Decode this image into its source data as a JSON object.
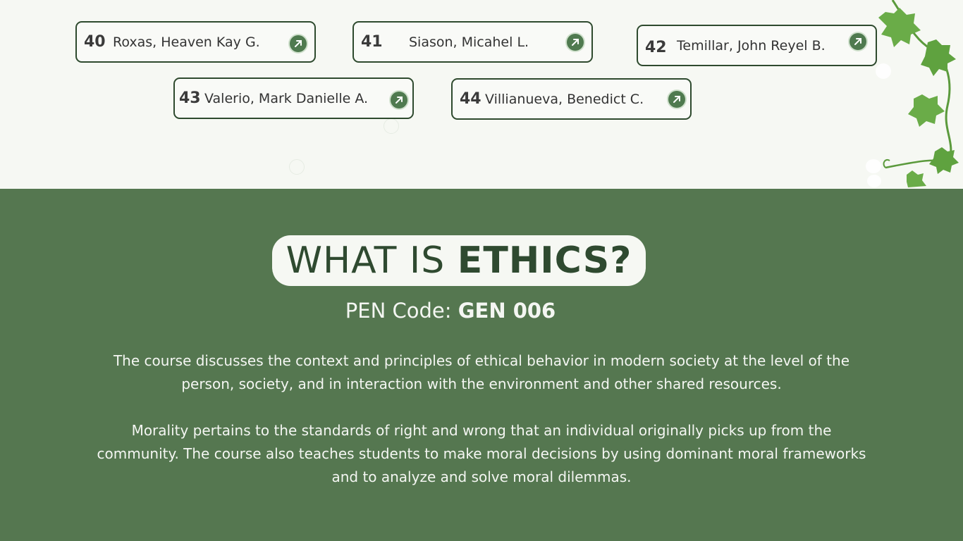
{
  "students": [
    {
      "number": "40",
      "name": "Roxas, Heaven Kay G."
    },
    {
      "number": "41",
      "name": "Siason, Micahel L."
    },
    {
      "number": "42",
      "name": "Temillar, John Reyel B."
    },
    {
      "number": "43",
      "name": "Valerio, Mark Danielle A."
    },
    {
      "number": "44",
      "name": "Villianueva, Benedict C."
    }
  ],
  "heading": {
    "prefix": "WHAT IS ",
    "emphasis": "ETHICS?"
  },
  "pen_code": {
    "label": "PEN Code: ",
    "value": "GEN 006"
  },
  "paragraphs": [
    "The course discusses the context and principles of ethical behavior in modern society at the level of the person, society, and in interaction with the environment and other shared resources.",
    "Morality pertains to the standards of right and wrong that an individual originally picks up from the community. The course also teaches students to make moral decisions by using dominant moral frameworks and to analyze and solve moral dilemmas."
  ],
  "icons": {
    "card_link": "arrow-up-right-icon",
    "decoration": "ivy-vine-icon"
  },
  "colors": {
    "top_background": "#f6f8f3",
    "bottom_background": "#557750",
    "accent": "#2f4a30"
  }
}
